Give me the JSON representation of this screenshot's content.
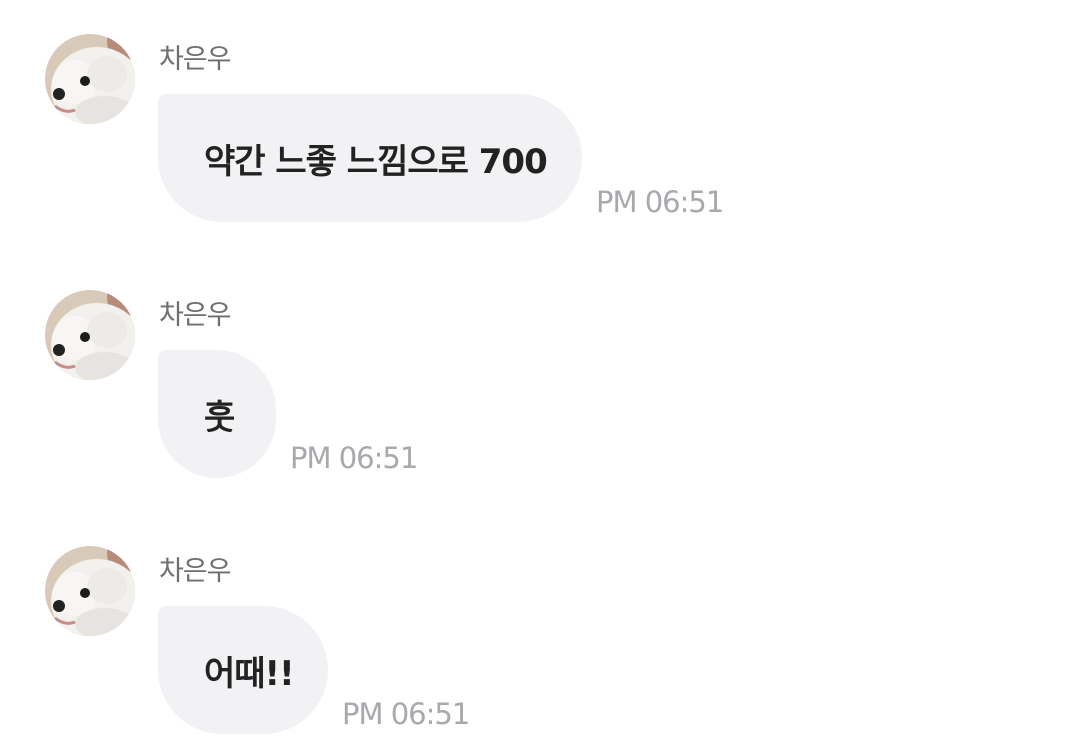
{
  "messages": [
    {
      "sender": "차은우",
      "text": "약간 느좋 느낌으로 700",
      "time": "PM 06:51"
    },
    {
      "sender": "차은우",
      "text": "훗",
      "time": "PM 06:51"
    },
    {
      "sender": "차은우",
      "text": "어때!!",
      "time": "PM 06:51"
    }
  ],
  "colors": {
    "bubble": "#f2f2f4",
    "text": "#222222",
    "sender": "#6e6e73",
    "time": "#a8a8ad"
  },
  "icons": {
    "avatar": "white-dog-photo-avatar"
  }
}
